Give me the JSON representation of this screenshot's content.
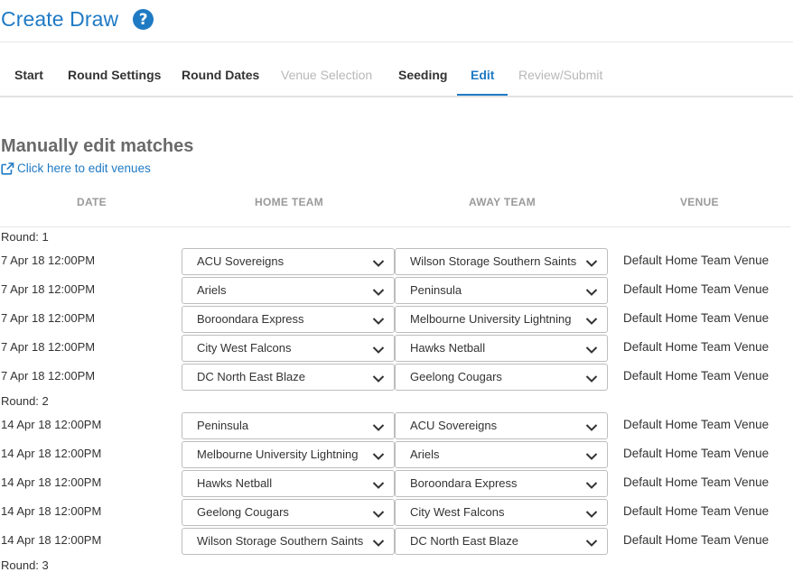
{
  "header": {
    "title": "Create Draw",
    "help_glyph": "?"
  },
  "tabs": [
    {
      "label": "Start",
      "state": "normal"
    },
    {
      "label": "Round Settings",
      "state": "normal"
    },
    {
      "label": "Round Dates",
      "state": "normal"
    },
    {
      "label": "Venue Selection",
      "state": "disabled"
    },
    {
      "label": "Seeding",
      "state": "normal"
    },
    {
      "label": "Edit",
      "state": "active"
    },
    {
      "label": "Review/Submit",
      "state": "disabled"
    }
  ],
  "section": {
    "title": "Manually edit matches",
    "edit_venues_link": "Click here to edit venues",
    "link_icon": "external-link-icon"
  },
  "table": {
    "headers": {
      "date": "DATE",
      "home": "HOME TEAM",
      "away": "AWAY TEAM",
      "venue": "VENUE"
    },
    "rounds": [
      {
        "label": "Round: 1",
        "matches": [
          {
            "date": "7 Apr 18 12:00PM",
            "home": "ACU Sovereigns",
            "away": "Wilson Storage Southern Saints",
            "venue": "Default Home Team Venue"
          },
          {
            "date": "7 Apr 18 12:00PM",
            "home": "Ariels",
            "away": "Peninsula",
            "venue": "Default Home Team Venue"
          },
          {
            "date": "7 Apr 18 12:00PM",
            "home": "Boroondara Express",
            "away": "Melbourne University Lightning",
            "venue": "Default Home Team Venue"
          },
          {
            "date": "7 Apr 18 12:00PM",
            "home": "City West Falcons",
            "away": "Hawks Netball",
            "venue": "Default Home Team Venue"
          },
          {
            "date": "7 Apr 18 12:00PM",
            "home": "DC North East Blaze",
            "away": "Geelong Cougars",
            "venue": "Default Home Team Venue"
          }
        ]
      },
      {
        "label": "Round: 2",
        "matches": [
          {
            "date": "14 Apr 18 12:00PM",
            "home": "Peninsula",
            "away": "ACU Sovereigns",
            "venue": "Default Home Team Venue"
          },
          {
            "date": "14 Apr 18 12:00PM",
            "home": "Melbourne University Lightning",
            "away": "Ariels",
            "venue": "Default Home Team Venue"
          },
          {
            "date": "14 Apr 18 12:00PM",
            "home": "Hawks Netball",
            "away": "Boroondara Express",
            "venue": "Default Home Team Venue"
          },
          {
            "date": "14 Apr 18 12:00PM",
            "home": "Geelong Cougars",
            "away": "City West Falcons",
            "venue": "Default Home Team Venue"
          },
          {
            "date": "14 Apr 18 12:00PM",
            "home": "Wilson Storage Southern Saints",
            "away": "DC North East Blaze",
            "venue": "Default Home Team Venue"
          }
        ]
      },
      {
        "label": "Round: 3",
        "matches": []
      }
    ]
  },
  "colors": {
    "accent": "#1f7ac4",
    "disabled_tab": "#b8b8b8",
    "header_text": "#9a9a9a"
  },
  "icons": {
    "help": "help-circle-icon",
    "dropdown": "chevron-down-icon"
  }
}
